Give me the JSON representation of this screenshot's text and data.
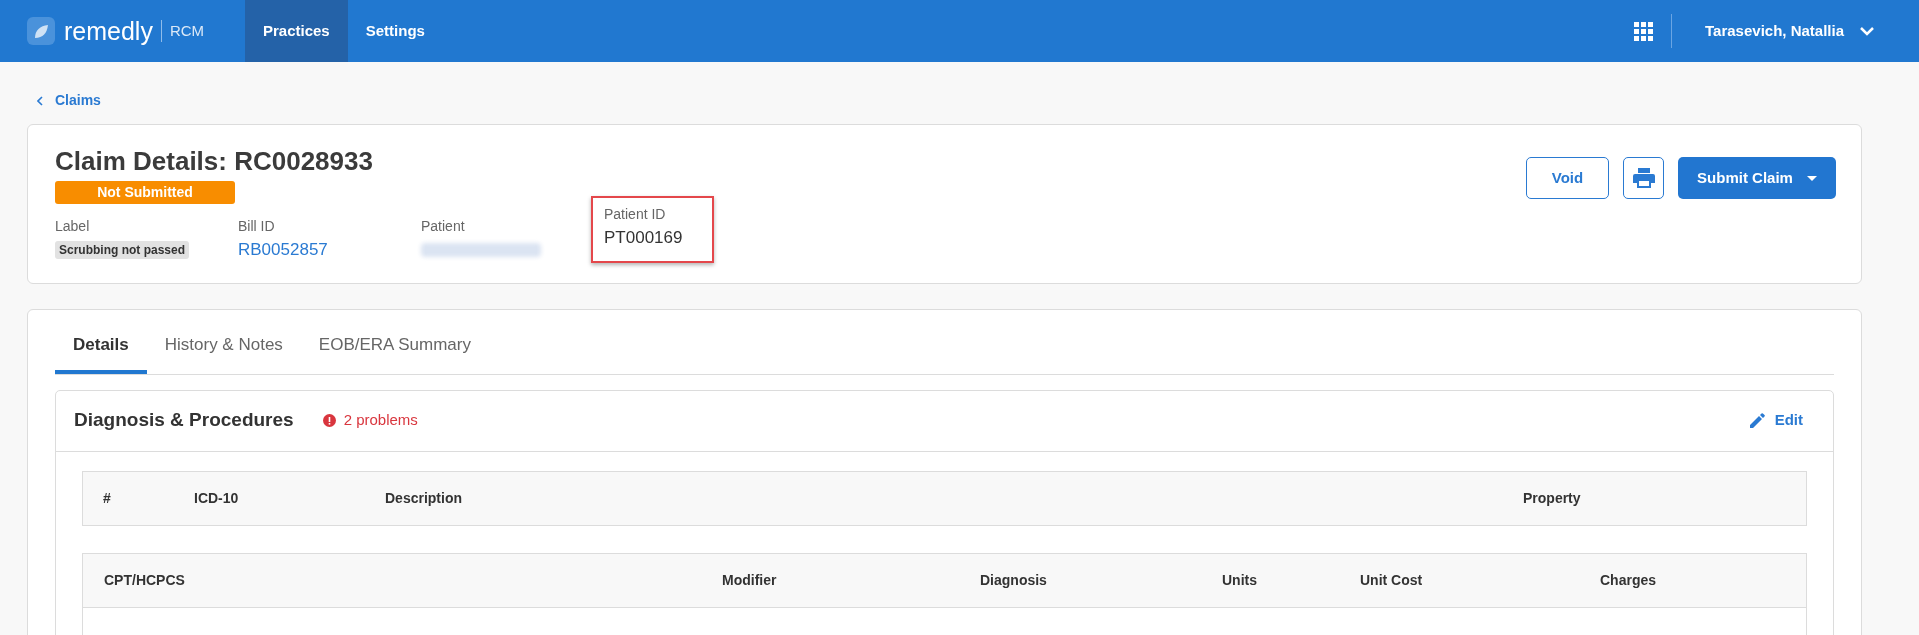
{
  "app": {
    "brand": "remedly",
    "product": "RCM"
  },
  "nav": [
    {
      "label": "Practices",
      "selected": true
    },
    {
      "label": "Settings",
      "selected": false
    }
  ],
  "user": {
    "name": "Tarasevich, Natallia"
  },
  "breadcrumb": {
    "label": "Claims"
  },
  "claim": {
    "title": "Claim Details: RC0028933",
    "status": "Not Submitted",
    "fields": [
      {
        "label": "Label",
        "kind": "tag",
        "value": "Scrubbing not passed",
        "highlighted": false
      },
      {
        "label": "Bill ID",
        "kind": "link",
        "value": "RB0052857",
        "highlighted": false
      },
      {
        "label": "Patient",
        "kind": "blurred",
        "highlighted": false
      },
      {
        "label": "Patient ID",
        "kind": "text",
        "value": "PT000169",
        "highlighted": true
      }
    ],
    "actions": [
      {
        "kind": "outline",
        "label": "Void"
      },
      {
        "kind": "print"
      },
      {
        "kind": "primary",
        "label": "Submit Claim"
      }
    ]
  },
  "tabs": [
    {
      "label": "Details",
      "selected": true
    },
    {
      "label": "History & Notes",
      "selected": false
    },
    {
      "label": "EOB/ERA Summary",
      "selected": false
    }
  ],
  "section": {
    "title": "Diagnosis & Procedures",
    "problems": "2 problems",
    "edit": "Edit",
    "diagnosis_table": {
      "columns": [
        "#",
        "ICD-10",
        "Description",
        "Property"
      ]
    },
    "procedure_table": {
      "columns": [
        "CPT/HCPCS",
        "Modifier",
        "Diagnosis",
        "Units",
        "Unit Cost",
        "Charges"
      ]
    }
  }
}
